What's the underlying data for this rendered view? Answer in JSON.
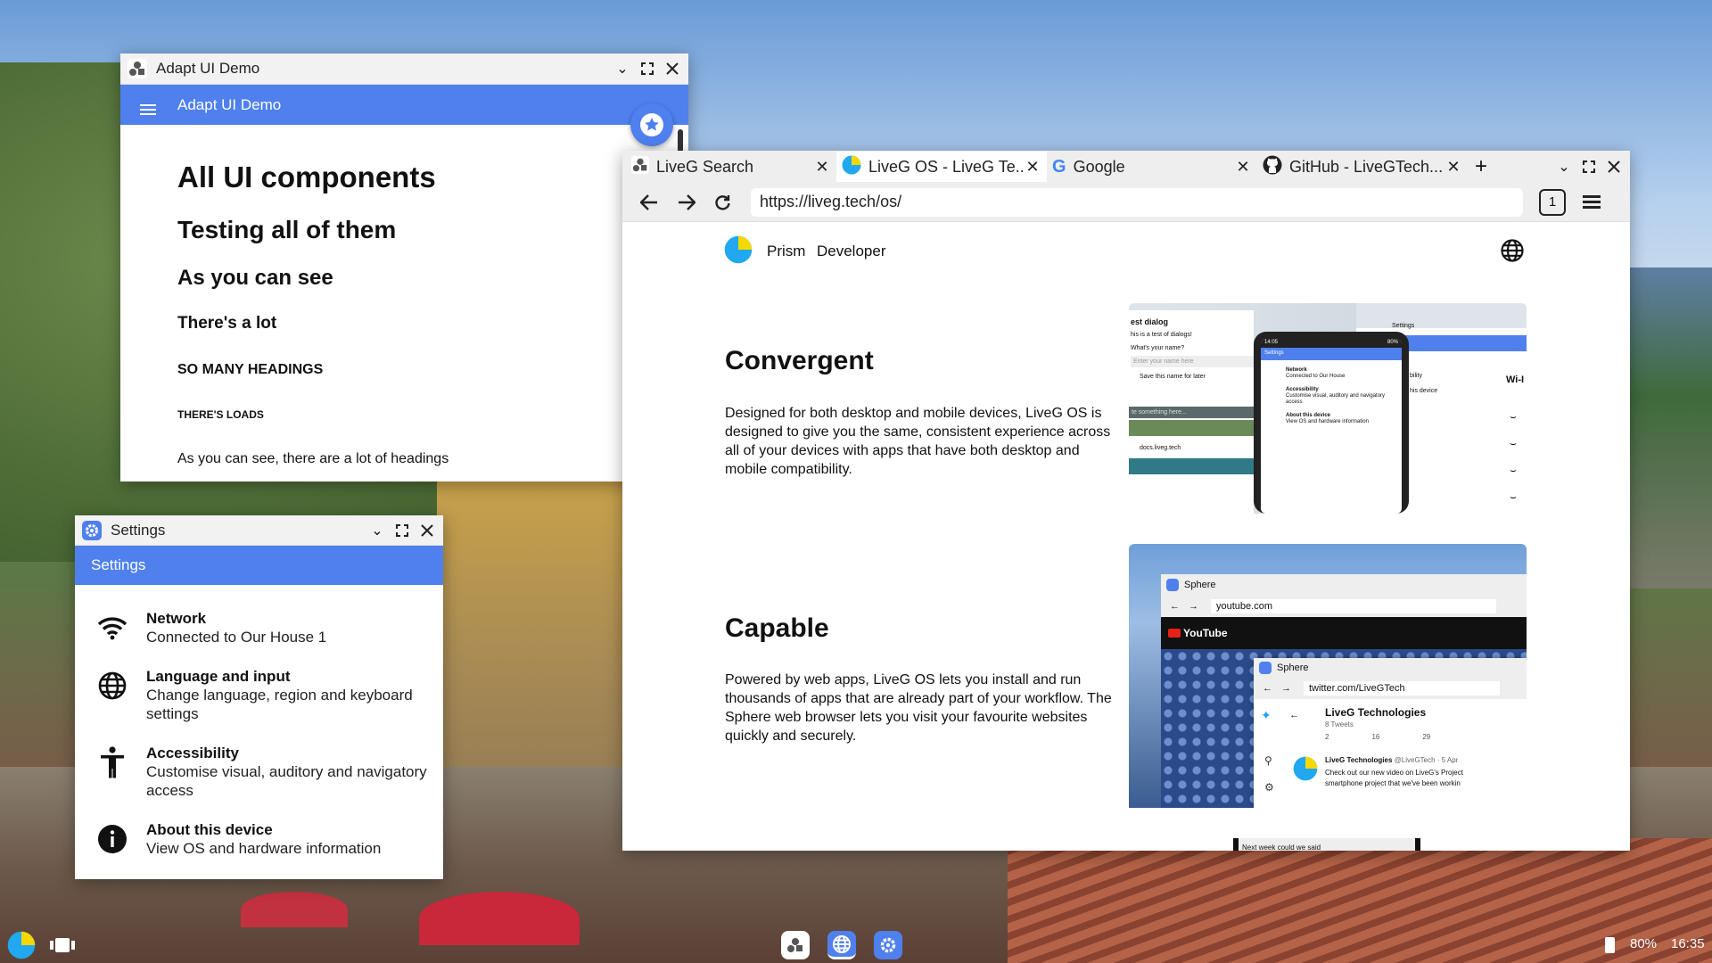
{
  "adapt_window": {
    "title": "Adapt UI Demo",
    "appbar_title": "Adapt UI Demo",
    "headings": [
      "All UI components",
      "Testing all of them",
      "As you can see",
      "There's a lot",
      "SO MANY HEADINGS",
      "THERE'S LOADS"
    ],
    "cut_text": "As you can see, there are a lot of headings"
  },
  "settings_window": {
    "title": "Settings",
    "appbar_title": "Settings",
    "items": [
      {
        "icon": "wifi-icon",
        "title": "Network",
        "subtitle": "Connected to Our House 1"
      },
      {
        "icon": "globe-icon",
        "title": "Language and input",
        "subtitle": "Change language, region and keyboard settings"
      },
      {
        "icon": "accessibility-icon",
        "title": "Accessibility",
        "subtitle": "Customise visual, auditory and navigatory access"
      },
      {
        "icon": "info-icon",
        "title": "About this device",
        "subtitle": "View OS and hardware information"
      }
    ]
  },
  "browser": {
    "tabs": [
      {
        "label": "LiveG Search",
        "icon": "liveg-search-icon"
      },
      {
        "label": "LiveG OS - LiveG Te...",
        "icon": "liveg-logo-icon"
      },
      {
        "label": "Google",
        "icon": "google-icon"
      },
      {
        "label": "GitHub - LiveGTech...",
        "icon": "github-icon"
      }
    ],
    "address": "https://liveg.tech/os/",
    "tab_count": "1",
    "nav_links": [
      "Prism",
      "Developer"
    ],
    "section1_title": "Convergent",
    "section1_body": "Designed for both desktop and mobile devices, LiveG OS is designed to give you the same, consistent experience across all of your devices with apps that have both desktop and mobile compatibility.",
    "section2_title": "Capable",
    "section2_body": "Powered by web apps, LiveG OS lets you install and run thousands of apps that are already part of your workflow. The Sphere web browser lets you visit your favourite websites quickly and securely.",
    "shot1": {
      "dialog_title": "est dialog",
      "dialog_text1": "his is a test of dialogs!",
      "dialog_text2": "What's your name?",
      "dialog_placeholder": "Enter your name here",
      "dialog_check": "Save this name for later",
      "dialog_input2": "te something here...",
      "url_chip": "docs.liveg.tech",
      "phone_time": "14:05",
      "phone_battery": "80%",
      "phone_bar": "Settings",
      "phone_items": [
        {
          "t": "Network",
          "s": "Connected to Our House"
        },
        {
          "t": "Accessibility",
          "s": "Customise visual, auditory and navigatory access"
        },
        {
          "t": "About this device",
          "s": "View OS and hardware information"
        }
      ],
      "back_title": "Settings",
      "back_text1": "bility",
      "back_text2": "his device",
      "wifi_label": "Wi-I"
    },
    "shot2": {
      "app1": "Sphere",
      "url1": "youtube.com",
      "yt": "YouTube",
      "app2": "Sphere",
      "url2": "twitter.com/LiveGTech",
      "profile": "LiveG Technologies",
      "tweets": "8 Tweets",
      "counts": [
        "2",
        "16",
        "29"
      ],
      "tweet_author": "LiveG Technologies",
      "tweet_handle": "@LiveGTech · 5 Apr",
      "tweet_text1": "Check out our new video on LiveG's Project",
      "tweet_text2": "smartphone project that we've been workin"
    },
    "bottom_cut": "Next week could we said"
  },
  "taskbar": {
    "battery": "80%",
    "time": "16:35"
  },
  "colors": {
    "accent": "#4f80ee",
    "logo_yellow": "#f5d800",
    "logo_blue": "#21a8f0"
  }
}
